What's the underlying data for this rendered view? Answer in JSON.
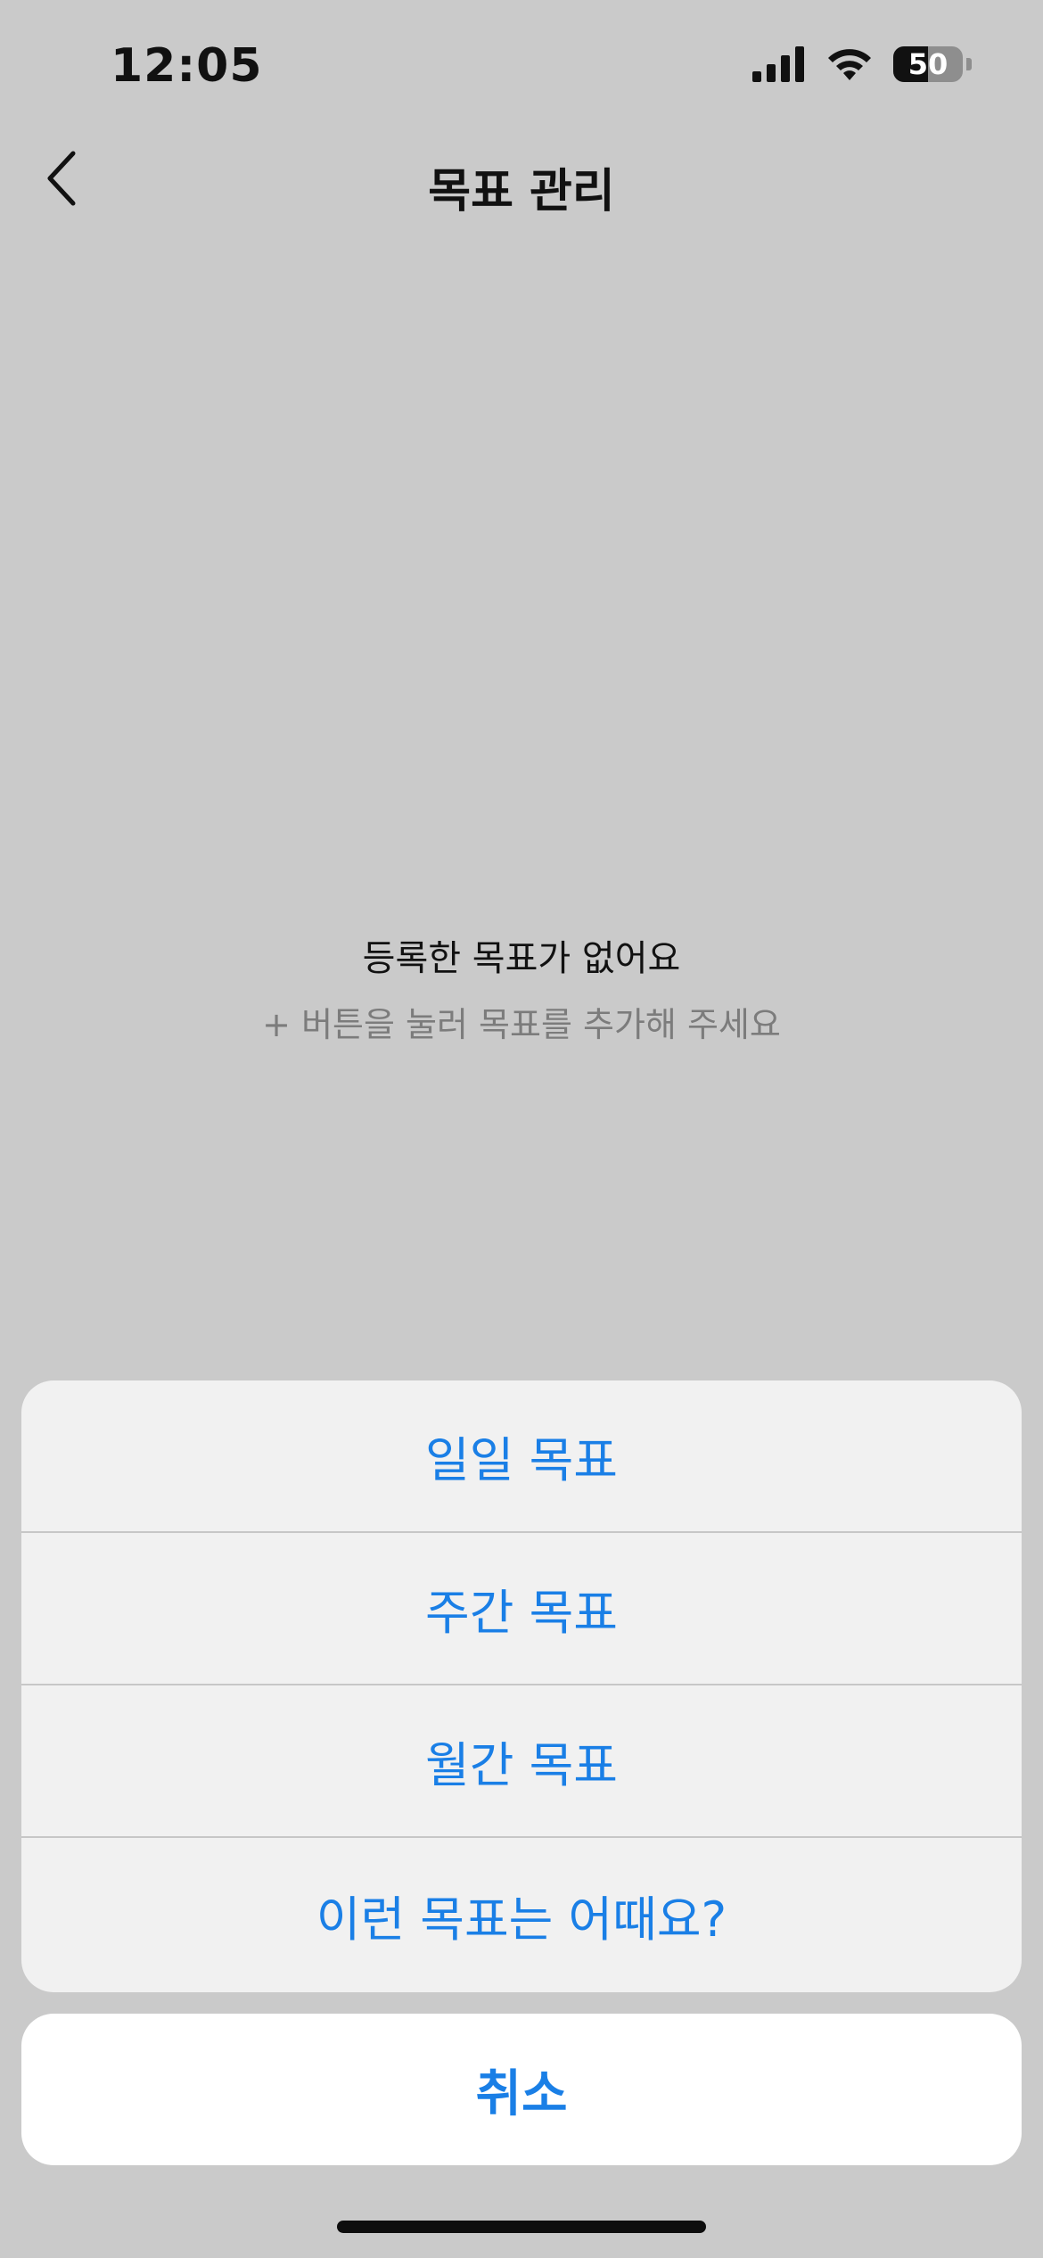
{
  "status_bar": {
    "time": "12:05",
    "battery_percent": "50",
    "battery_level": 0.5,
    "icons": [
      "signal-icon",
      "wifi-icon",
      "battery-icon"
    ]
  },
  "nav": {
    "title": "목표 관리",
    "back_icon": "chevron-left-icon"
  },
  "empty_state": {
    "title": "등록한 목표가 없어요",
    "subtitle": "+ 버튼을 눌러 목표를 추가해 주세요"
  },
  "action_sheet": {
    "items": [
      {
        "label": "일일 목표"
      },
      {
        "label": "주간 목표"
      },
      {
        "label": "월간 목표"
      },
      {
        "label": "이런 목표는 어때요?"
      }
    ],
    "cancel_label": "취소"
  },
  "colors": {
    "background": "#cacaca",
    "accent": "#1a7fe6",
    "sheet": "#f1f1f1",
    "cancel_bg": "#ffffff"
  }
}
